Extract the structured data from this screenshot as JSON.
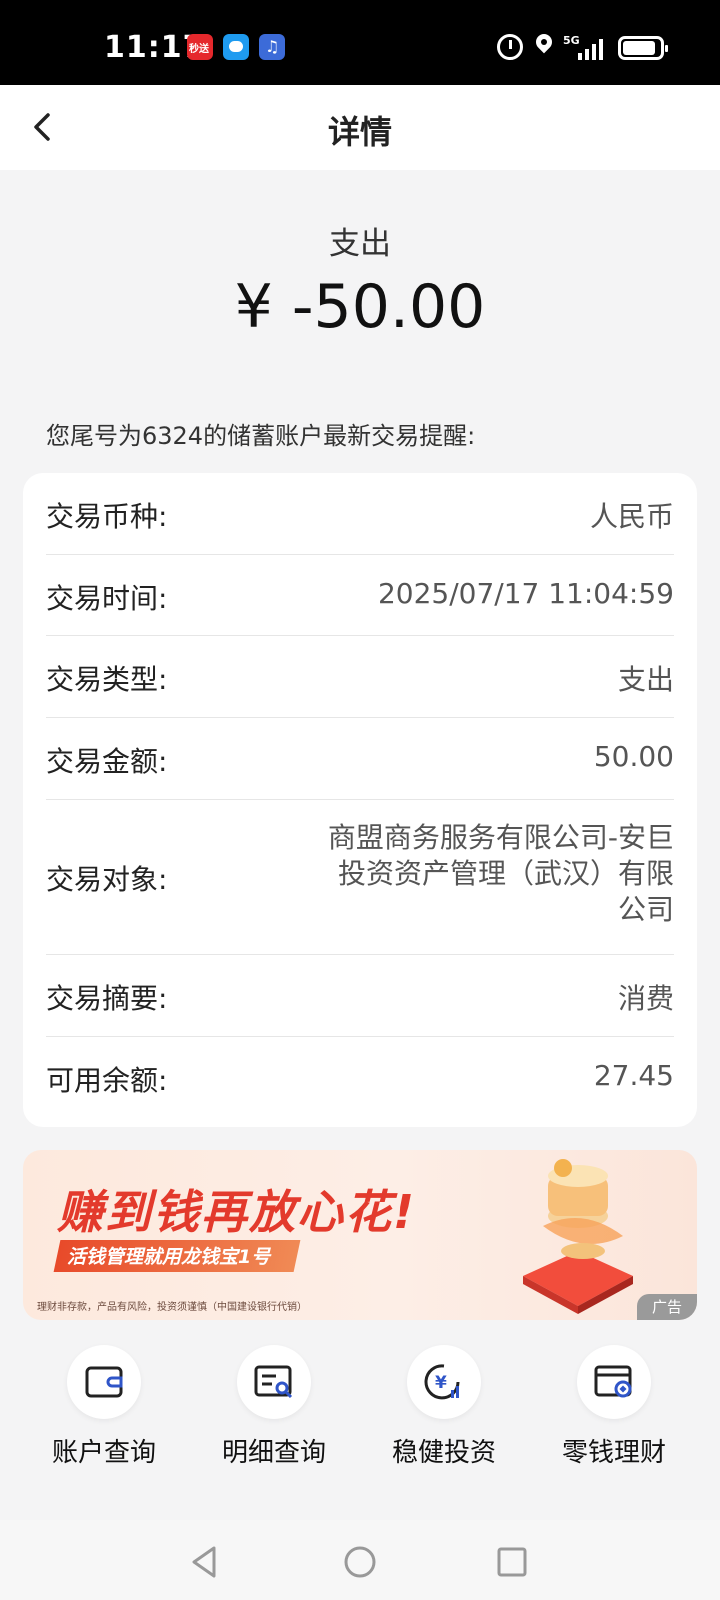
{
  "status_bar": {
    "time": "11:17",
    "notif_app1_text": "秒送",
    "network": "5G",
    "signal_level": 4
  },
  "header": {
    "back_icon": "chevron-left-icon",
    "title": "详情"
  },
  "summary": {
    "type_label": "支出",
    "amount": "¥ -50.00"
  },
  "notice": "您尾号为6324的储蓄账户最新交易提醒:",
  "details": [
    {
      "label": "交易币种:",
      "value": "人民币"
    },
    {
      "label": "交易时间:",
      "value": "2025/07/17 11:04:59"
    },
    {
      "label": "交易类型:",
      "value": "支出"
    },
    {
      "label": "交易金额:",
      "value": "50.00"
    },
    {
      "label": "交易对象:",
      "value": "商盟商务服务有限公司-安巨投资资产管理（武汉）有限公司"
    },
    {
      "label": "交易摘要:",
      "value": "消费"
    },
    {
      "label": "可用余额:",
      "value": "27.45"
    }
  ],
  "ad": {
    "headline": "赚到钱再放心花!",
    "subline": "活钱管理就用龙钱宝1号",
    "disclaimer": "理财非存款，产品有风险，投资须谨慎（中国建设银行代销）",
    "tag": "广告"
  },
  "quick_actions": [
    {
      "label": "账户查询",
      "icon": "wallet-icon"
    },
    {
      "label": "明细查询",
      "icon": "statement-search-icon"
    },
    {
      "label": "稳健投资",
      "icon": "yuan-chart-icon"
    },
    {
      "label": "零钱理财",
      "icon": "card-coin-icon"
    }
  ],
  "colors": {
    "ad_headline": "#e33a2c",
    "page_bg": "#f4f4f5",
    "card_bg": "#ffffff",
    "icon_accent": "#2f55c8"
  },
  "nav_bar": {
    "icons": [
      "back-triangle-icon",
      "home-circle-icon",
      "recents-square-icon"
    ]
  }
}
